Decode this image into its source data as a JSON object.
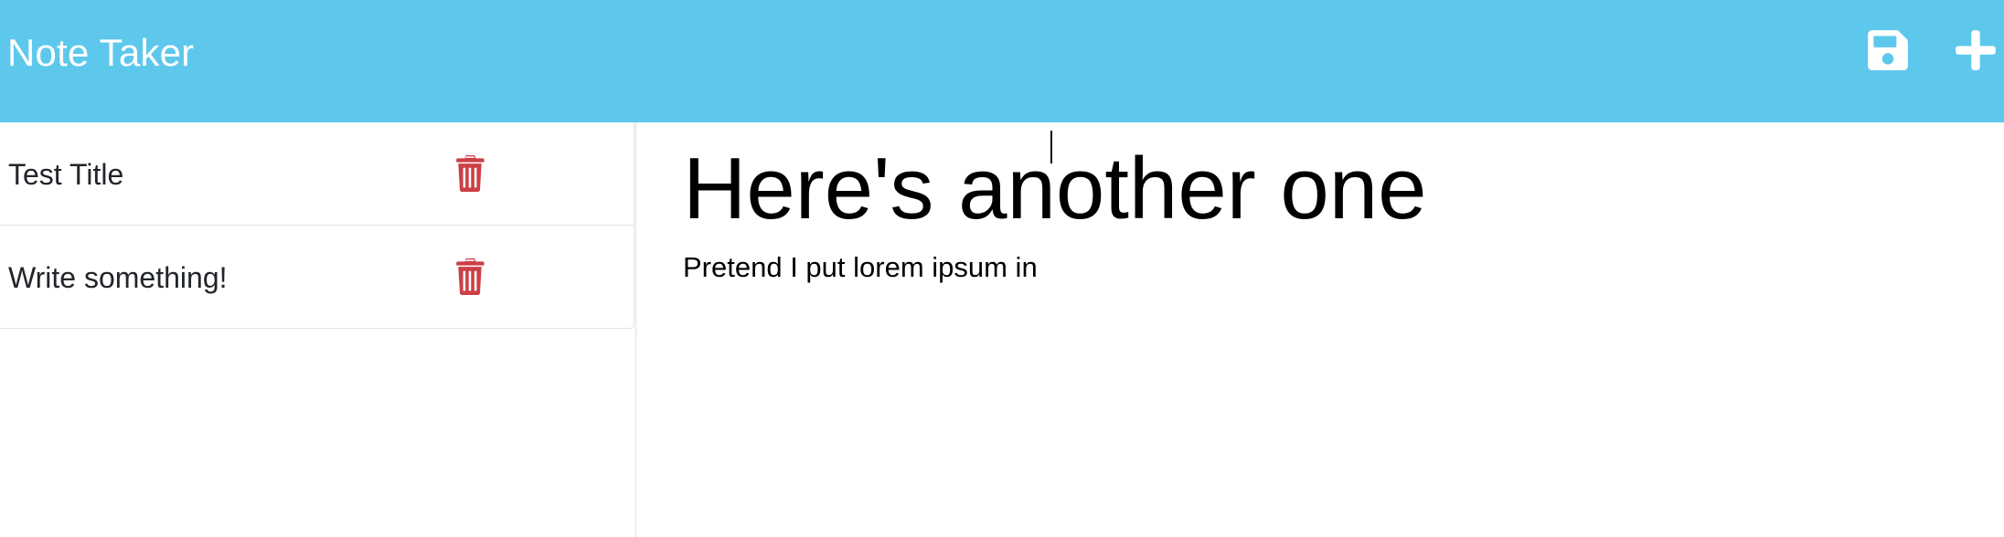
{
  "app": {
    "brand": "Note Taker"
  },
  "navbar": {
    "background_color": "#5ec8ec",
    "icons": [
      "save-icon",
      "plus-icon"
    ]
  },
  "notes": [
    {
      "title": "Test Title",
      "delete_icon": "trash-icon"
    },
    {
      "title": "Write something!",
      "delete_icon": "trash-icon"
    }
  ],
  "editor": {
    "title_value": "Here's another one",
    "text_value": "Pretend I put lorem ipsum in"
  },
  "colors": {
    "accent": "#5ec8ec",
    "delete": "#cc3f46",
    "text": "#212529"
  }
}
